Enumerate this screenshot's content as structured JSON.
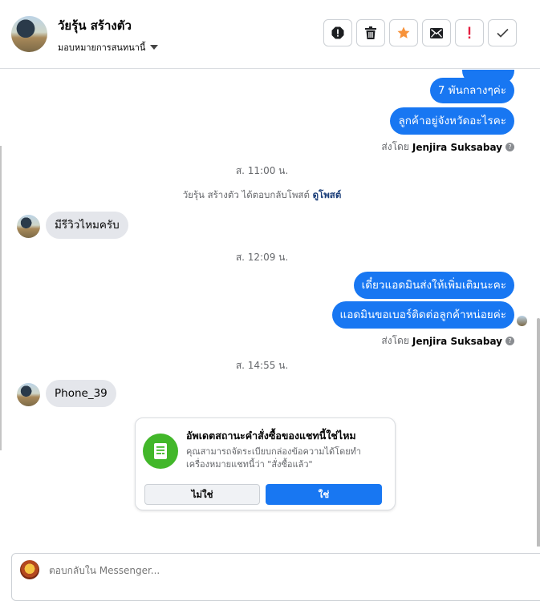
{
  "header": {
    "contact_name": "วัยรุ้น สร้างตัว",
    "assign_label": "มอบหมายการสนทนานี้",
    "toolbar": [
      {
        "name": "spam-button",
        "icon": "alert-octagon-icon"
      },
      {
        "name": "delete-button",
        "icon": "trash-icon"
      },
      {
        "name": "star-button",
        "icon": "star-icon"
      },
      {
        "name": "mark-unread-button",
        "icon": "envelope-icon"
      },
      {
        "name": "follow-up-button",
        "icon": "exclamation-icon"
      },
      {
        "name": "mark-done-button",
        "icon": "check-icon"
      }
    ]
  },
  "chat": {
    "out_1": "7 พันกลางๆค่ะ",
    "out_2": "ลูกค้าอยู่จังหวัดอะไรคะ",
    "sent_by_label": "ส่งโดย",
    "sent_by_name": "Jenjira Suksabay",
    "time_1": "ส. 11:00 น.",
    "sys_text": "วัยรุ้น สร้างตัว ได้ตอบกลับโพสต์",
    "sys_link": "ดูโพสต์",
    "in_1": "มีรีวิวไหมครับ",
    "time_2": "ส. 12:09 น.",
    "out_3": "เดี๋ยวแอดมินส่งให้เพิ่มเติมนะคะ",
    "out_4": "แอดมินขอเบอร์ติดต่อลูกค้าหน่อยค่ะ",
    "time_3": "ส. 14:55 น.",
    "in_2": "Phone_39"
  },
  "card": {
    "title": "อัพเดตสถานะคำสั่งซื้อของแชทนี้ใช่ไหม",
    "body": "คุณสามารถจัดระเบียบกล่องข้อความได้โดยทำเครื่องหมายแชทนี้ว่า \"สั่งซื้อแล้ว\"",
    "no_label": "ไม่ใช่",
    "yes_label": "ใช่"
  },
  "reply": {
    "placeholder": "ตอบกลับใน Messenger..."
  },
  "colors": {
    "accent": "#1877f2",
    "bubble_in": "#e4e6eb",
    "success": "#42b72a",
    "star": "#f7923a",
    "alert": "#e41e3f"
  }
}
